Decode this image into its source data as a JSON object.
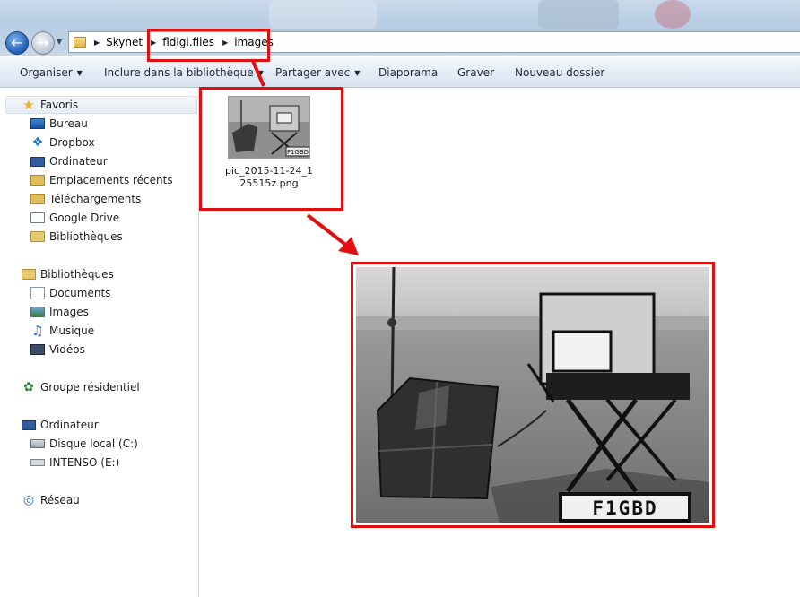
{
  "address_bar": {
    "crumbs": [
      "Skynet",
      "fldigi.files",
      "images"
    ]
  },
  "toolbar": {
    "organize": "Organiser",
    "include_library": "Inclure dans la bibliothèque",
    "share_with": "Partager avec",
    "slideshow": "Diaporama",
    "burn": "Graver",
    "new_folder": "Nouveau dossier"
  },
  "sidebar": {
    "favorites": {
      "header": "Favoris",
      "items": [
        "Bureau",
        "Dropbox",
        "Ordinateur",
        "Emplacements récents",
        "Téléchargements",
        "Google Drive",
        "Bibliothèques"
      ]
    },
    "libraries": {
      "header": "Bibliothèques",
      "items": [
        "Documents",
        "Images",
        "Musique",
        "Vidéos"
      ]
    },
    "homegroup": "Groupe résidentiel",
    "computer": {
      "header": "Ordinateur",
      "items": [
        "Disque local (C:)",
        "INTENSO (E:)"
      ]
    },
    "network": "Réseau"
  },
  "files": [
    {
      "name": "pic_2015-11-24_125515z.png",
      "label_line1": "pic_2015-11-24_1",
      "label_line2": "25515z.png"
    }
  ],
  "preview": {
    "plate_text": "F1GBD"
  },
  "colors": {
    "annotation": "#e01010",
    "selection_bg": "#e7edf5"
  }
}
